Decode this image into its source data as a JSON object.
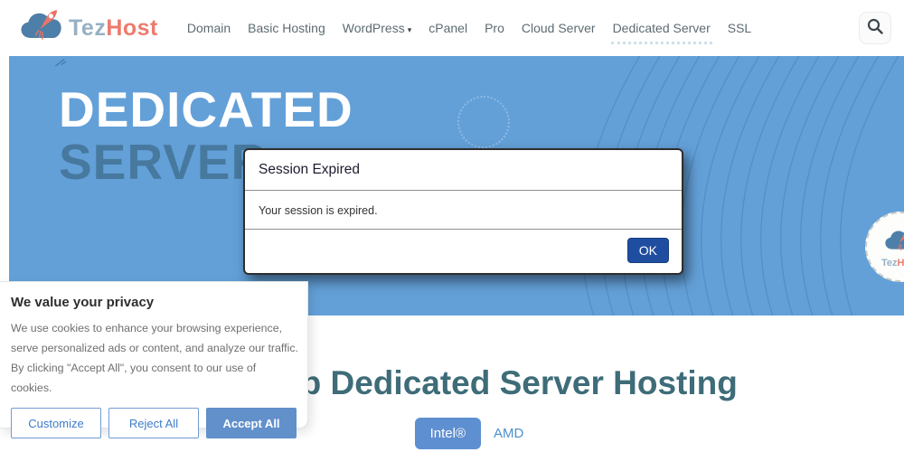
{
  "header": {
    "logo": {
      "text_primary": "Tez",
      "text_secondary": "Host"
    },
    "wordpress_caret": "▾",
    "nav": [
      {
        "label": "Domain"
      },
      {
        "label": "Basic Hosting"
      },
      {
        "label": "WordPress"
      },
      {
        "label": "cPanel"
      },
      {
        "label": "Pro"
      },
      {
        "label": "Cloud Server"
      },
      {
        "label": "Dedicated Server",
        "active": true
      },
      {
        "label": "SSL"
      }
    ]
  },
  "hero": {
    "line1": "DEDICATED",
    "line2": "SERVER",
    "badge": {
      "text_primary": "Tez",
      "text_secondary": "Host"
    }
  },
  "modal": {
    "title": "Session Expired",
    "body": "Your session is expired.",
    "ok_label": "OK"
  },
  "cookie": {
    "title": "We value your privacy",
    "body": "We use cookies to enhance your browsing experience, serve personalized ads or content, and analyze our traffic. By clicking \"Accept All\", you consent to our use of cookies.",
    "buttons": [
      {
        "label": "Customize"
      },
      {
        "label": "Reject All"
      },
      {
        "label": "Accept All",
        "primary": true
      }
    ]
  },
  "main": {
    "heading": "Cheap Dedicated Server Hosting",
    "tabs": [
      {
        "label": "Intel®",
        "active": true
      },
      {
        "label": "AMD"
      }
    ]
  },
  "colors": {
    "hero_background": "#63a0d8",
    "hero_line2": "#47799f",
    "heading_teal": "#3e6c78",
    "logo_tez": "#96b0c4",
    "logo_host": "#ec7b6e",
    "ok_button": "#1f4ea1",
    "accept_button": "#6190cb",
    "tab_active": "#5e8fd0"
  }
}
